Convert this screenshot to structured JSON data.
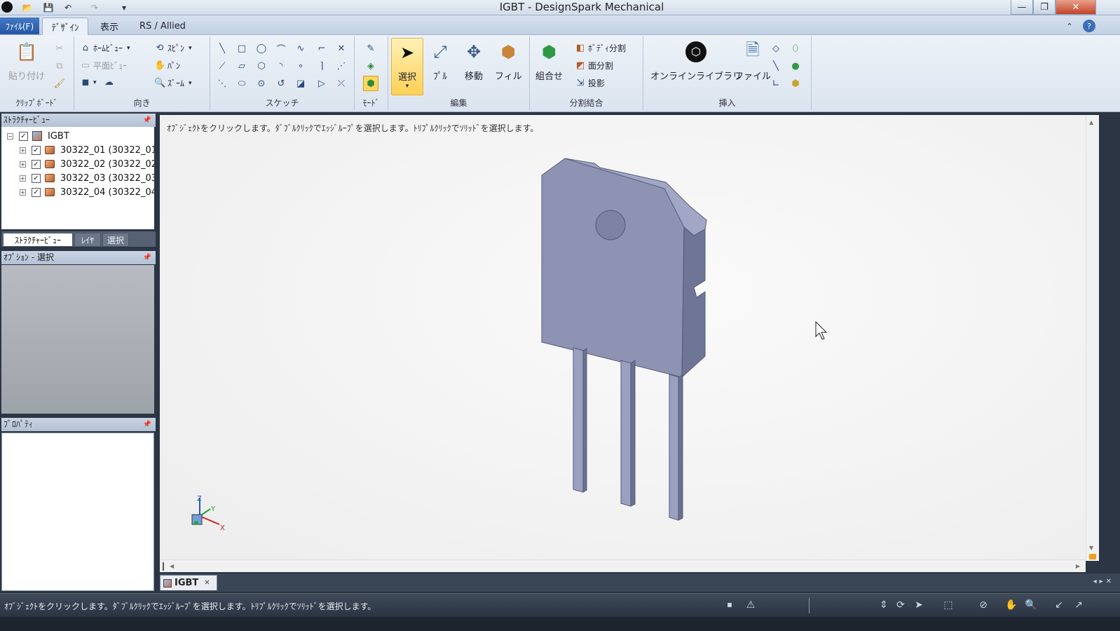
{
  "window": {
    "title": "IGBT - DesignSpark Mechanical",
    "minimize": "—",
    "restore": "❐",
    "close": "✕"
  },
  "quick_access": {
    "open": "📂",
    "save": "💾",
    "undo": "↶",
    "redo": "↷",
    "more": "▾"
  },
  "menu": {
    "file": "ﾌｧｲﾙ(F)",
    "tabs": [
      "ﾃﾞｻﾞｲﾝ",
      "表示",
      "RS / Allied"
    ],
    "collapse": "⌃",
    "help": "?"
  },
  "ribbon": {
    "clipboard": {
      "label": "ｸﾘｯﾌﾟﾎﾞｰﾄﾞ",
      "paste": "貼り付け"
    },
    "orient": {
      "label": "向き",
      "home": "ﾎｰﾑﾋﾞｭｰ",
      "plan": "平面ﾋﾞｭｰ",
      "spin": "ｽﾋﾟﾝ",
      "pan": "ﾊﾟﾝ",
      "zoom": "ｽﾞｰﾑ"
    },
    "sketch": {
      "label": "スケッチ"
    },
    "mode": {
      "label": "ﾓｰﾄﾞ"
    },
    "edit": {
      "label": "編集",
      "select": "選択",
      "pull": "ﾌﾟﾙ",
      "move": "移動",
      "fill": "フィル"
    },
    "intersect": {
      "label": "分割結合",
      "combine": "組合せ",
      "split_body": "ﾎﾞﾃﾞｨ分割",
      "split_face": "面分割",
      "project": "投影"
    },
    "insert": {
      "label": "挿入",
      "online_library": "オンラインライブラリ",
      "file": "ファイル"
    }
  },
  "structure": {
    "header": "ｽﾄﾗｸﾁｬｰﾋﾞｭｰ",
    "root": "IGBT",
    "items": [
      "30322_01 (30322_01",
      "30322_02 (30322_02",
      "30322_03 (30322_03",
      "30322_04 (30322_04"
    ],
    "tabs": [
      "ｽﾄﾗｸﾁｬｰﾋﾞｭｰ",
      "ﾚｲﾔ",
      "選択"
    ]
  },
  "options": {
    "header": "ｵﾌﾟｼｮﾝ - 選択"
  },
  "properties": {
    "header": "ﾌﾟﾛﾊﾟﾃｨ"
  },
  "viewport": {
    "hint": "ｵﾌﾞｼﾞｪｸﾄをクリックします。ﾀﾞﾌﾞﾙｸﾘｯｸでｴｯｼﾞﾙｰﾌﾟを選択します。ﾄﾘﾌﾟﾙｸﾘｯｸでｿﾘｯﾄﾞを選択します。",
    "axes": {
      "x": "X",
      "y": "Y",
      "z": "Z"
    },
    "body_color": "#8e93b3"
  },
  "document_tab": {
    "name": "IGBT",
    "close": "✕"
  },
  "status": {
    "text": "ｵﾌﾞｼﾞｪｸﾄをクリックします。ﾀﾞﾌﾞﾙｸﾘｯｸでｴｯｼﾞﾙｰﾌﾟを選択します。ﾄﾘﾌﾟﾙｸﾘｯｸでｿﾘｯﾄﾞを選択します。"
  }
}
